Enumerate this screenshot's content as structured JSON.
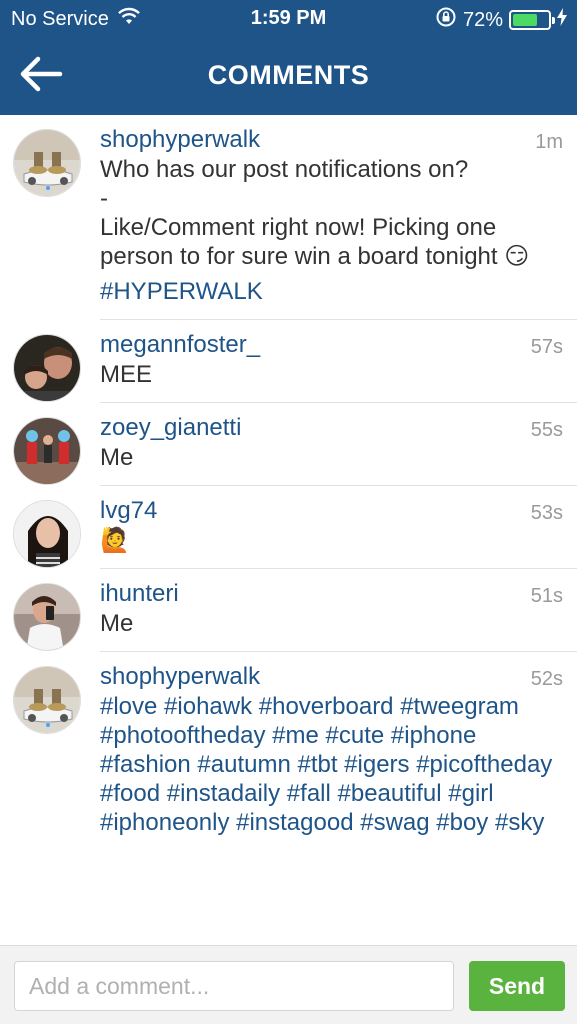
{
  "status_bar": {
    "carrier": "No Service",
    "time": "1:59 PM",
    "battery_percent": "72%",
    "battery_level": 0.72,
    "colors": {
      "background": "#1f5488",
      "battery_fill": "#4cd964"
    }
  },
  "header": {
    "title": "COMMENTS",
    "back_icon": "arrow-left-icon"
  },
  "comments": [
    {
      "username": "shophyperwalk",
      "time": "1m",
      "text": "Who has our post notifications on?\n-\nLike/Comment right now! Picking one person to for sure win a board tonight 😏",
      "hashtags": "#HYPERWALK",
      "avatar": "hoverboard-avatar"
    },
    {
      "username": "megannfoster_",
      "time": "57s",
      "text": "MEE",
      "avatar": "selfie-avatar"
    },
    {
      "username": "zoey_gianetti",
      "time": "55s",
      "text": "Me",
      "avatar": "group-avatar"
    },
    {
      "username": "lvg74",
      "time": "53s",
      "text": "🙋",
      "avatar": "girl-avatar"
    },
    {
      "username": "ihunteri",
      "time": "51s",
      "text": "Me",
      "avatar": "mirror-selfie-avatar"
    },
    {
      "username": "shophyperwalk",
      "time": "52s",
      "text": "",
      "hashtags": "#love #iohawk #hoverboard #tweegram #photooftheday #me #cute #iphone #fashion #autumn #tbt #igers #picoftheday #food #instadaily #fall #beautiful #girl #iphoneonly #instagood #swag #boy #sky",
      "avatar": "hoverboard-avatar"
    }
  ],
  "input_bar": {
    "placeholder": "Add a comment...",
    "value": "",
    "send_label": "Send",
    "send_color": "#5bb33f"
  },
  "colors": {
    "link": "#1f5488",
    "timestamp": "#9a9a9a"
  }
}
